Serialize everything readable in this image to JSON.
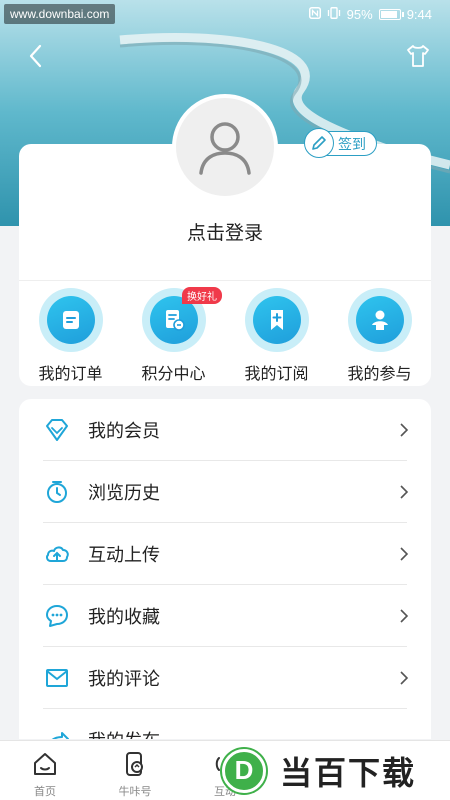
{
  "status_bar": {
    "watermark": "www.downbai.com",
    "battery": "95%",
    "time": "9:44",
    "battery_level": 0.95
  },
  "profile": {
    "signin_label": "签到",
    "login_prompt": "点击登录"
  },
  "quick_actions": [
    {
      "label": "我的订单",
      "icon": "order-icon"
    },
    {
      "label": "积分中心",
      "icon": "points-icon",
      "badge": "换好礼"
    },
    {
      "label": "我的订阅",
      "icon": "bookmark-icon"
    },
    {
      "label": "我的参与",
      "icon": "person-icon"
    }
  ],
  "menu": [
    {
      "label": "我的会员",
      "icon": "diamond-icon"
    },
    {
      "label": "浏览历史",
      "icon": "clock-icon"
    },
    {
      "label": "互动上传",
      "icon": "cloud-upload-icon"
    },
    {
      "label": "我的收藏",
      "icon": "chat-icon"
    },
    {
      "label": "我的评论",
      "icon": "mail-icon"
    },
    {
      "label": "我的发布",
      "icon": "share-icon"
    }
  ],
  "tabs": [
    {
      "label": "首页",
      "icon": "home-icon"
    },
    {
      "label": "牛咔号",
      "icon": "phone-icon"
    },
    {
      "label": "互动",
      "icon": "radio-icon"
    },
    {
      "label": "",
      "icon": ""
    },
    {
      "label": "",
      "icon": ""
    }
  ],
  "watermark_bottom": {
    "logo_letter": "D",
    "text": "当百下载"
  },
  "colors": {
    "accent": "#2c9fc4",
    "icon_blue": "#1fa6d8",
    "badge_red": "#f03a4a",
    "brand_green": "#3fb04a"
  }
}
